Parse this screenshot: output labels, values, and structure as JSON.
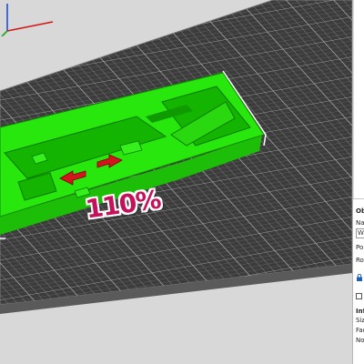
{
  "viewport": {
    "scale_label": "110%",
    "bed_color": "#3a3a3a",
    "model_color": "#22e60a",
    "arrow_color": "#d2161c"
  },
  "sidebar": {
    "section_object": "Ob",
    "name_label": "Na",
    "name_value": "W",
    "position_label": "Po",
    "rotation_label": "Ro",
    "info_section": "Inf",
    "size_label": "Size",
    "facets_label": "Face",
    "no_label": "No"
  }
}
